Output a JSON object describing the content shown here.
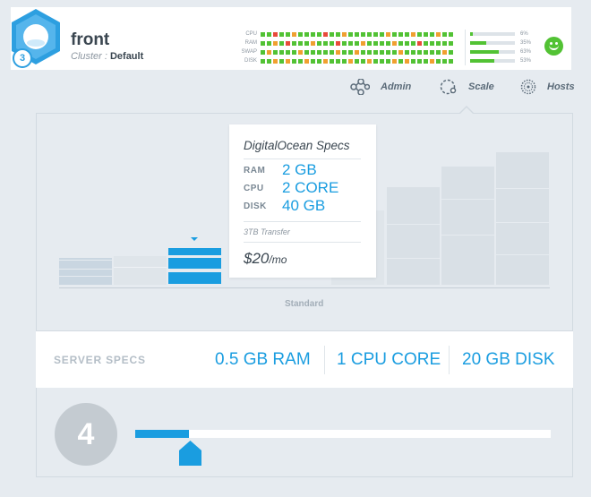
{
  "app": {
    "name": "front",
    "instance_count_badge": "3"
  },
  "cluster": {
    "label": "Cluster :",
    "value": "Default"
  },
  "metrics": {
    "rows": [
      {
        "label": "CPU",
        "cells": [
          "#52c234",
          "#52c234",
          "#e84a3a",
          "#52c234",
          "#52c234",
          "#f0a030",
          "#52c234",
          "#52c234",
          "#52c234",
          "#52c234",
          "#e84a3a",
          "#52c234",
          "#52c234",
          "#f0a030",
          "#52c234",
          "#52c234",
          "#52c234",
          "#52c234",
          "#52c234",
          "#52c234",
          "#f0a030",
          "#52c234",
          "#52c234",
          "#52c234",
          "#f0a030",
          "#52c234",
          "#52c234",
          "#52c234",
          "#f0a030",
          "#52c234",
          "#52c234"
        ]
      },
      {
        "label": "RAM",
        "cells": [
          "#52c234",
          "#52c234",
          "#f0a030",
          "#52c234",
          "#e84a3a",
          "#52c234",
          "#52c234",
          "#52c234",
          "#f0a030",
          "#52c234",
          "#52c234",
          "#52c234",
          "#e84a3a",
          "#52c234",
          "#52c234",
          "#52c234",
          "#f0a030",
          "#52c234",
          "#52c234",
          "#52c234",
          "#52c234",
          "#f0a030",
          "#52c234",
          "#52c234",
          "#52c234",
          "#e84a3a",
          "#52c234",
          "#52c234",
          "#52c234",
          "#52c234",
          "#52c234"
        ]
      },
      {
        "label": "SWAP",
        "cells": [
          "#52c234",
          "#f0a030",
          "#52c234",
          "#52c234",
          "#52c234",
          "#52c234",
          "#f0a030",
          "#52c234",
          "#52c234",
          "#52c234",
          "#52c234",
          "#52c234",
          "#f0a030",
          "#52c234",
          "#52c234",
          "#f0a030",
          "#52c234",
          "#52c234",
          "#52c234",
          "#52c234",
          "#52c234",
          "#52c234",
          "#f0a030",
          "#52c234",
          "#52c234",
          "#52c234",
          "#52c234",
          "#52c234",
          "#52c234",
          "#f0a030",
          "#52c234"
        ]
      },
      {
        "label": "DISK",
        "cells": [
          "#52c234",
          "#52c234",
          "#f0a030",
          "#52c234",
          "#f0a030",
          "#52c234",
          "#52c234",
          "#f0a030",
          "#52c234",
          "#52c234",
          "#f0a030",
          "#52c234",
          "#52c234",
          "#52c234",
          "#f0a030",
          "#52c234",
          "#52c234",
          "#f0a030",
          "#52c234",
          "#52c234",
          "#52c234",
          "#f0a030",
          "#52c234",
          "#f0a030",
          "#52c234",
          "#52c234",
          "#52c234",
          "#f0a030",
          "#52c234",
          "#52c234",
          "#52c234"
        ]
      }
    ],
    "usage": [
      {
        "label": "6%",
        "fraction": 0.06
      },
      {
        "label": "35%",
        "fraction": 0.35
      },
      {
        "label": "63%",
        "fraction": 0.63
      },
      {
        "label": "53%",
        "fraction": 0.53
      }
    ],
    "status_icon": "smiley-icon",
    "status_color": "#52c234"
  },
  "nav": {
    "admin": "Admin",
    "scale": "Scale",
    "hosts": "Hosts"
  },
  "plans": {
    "category_label": "Standard",
    "tooltip": {
      "title": "DigitalOcean Specs",
      "ram_label": "RAM",
      "ram_value": "2 GB",
      "cpu_label": "CPU",
      "cpu_value": "2 CORE",
      "disk_label": "DISK",
      "disk_value": "40 GB",
      "transfer": "3TB Transfer",
      "price": "$20",
      "price_unit": "/mo"
    }
  },
  "server_specs": {
    "label": "SERVER SPECS",
    "ram": "0.5 GB RAM",
    "cpu": "1 CPU CORE",
    "disk": "20 GB DISK"
  },
  "scale": {
    "count": "4",
    "slider_fraction": 0.13
  },
  "colors": {
    "accent": "#1a9de0",
    "good": "#52c234",
    "warn": "#f0a030",
    "bad": "#e84a3a"
  }
}
